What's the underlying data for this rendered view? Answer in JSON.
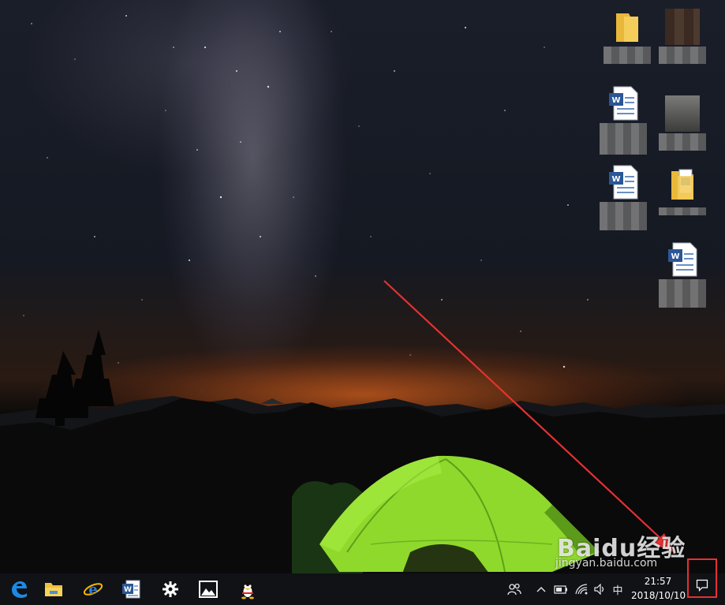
{
  "desktop": {
    "icons": [
      {
        "type": "folder-icon",
        "label": ""
      },
      {
        "type": "image-file-icon",
        "label": ""
      },
      {
        "type": "word-document-icon",
        "label": ""
      },
      {
        "type": "image-file-icon",
        "label": ""
      },
      {
        "type": "word-document-icon",
        "label": ""
      },
      {
        "type": "folder-with-documents-icon",
        "label": ""
      },
      {
        "type": "word-document-icon",
        "label": ""
      }
    ]
  },
  "taskbar": {
    "apps": [
      {
        "name": "Microsoft Edge",
        "icon": "edge-icon"
      },
      {
        "name": "File Explorer",
        "icon": "folder-icon"
      },
      {
        "name": "Internet Explorer",
        "icon": "internet-explorer-icon"
      },
      {
        "name": "Microsoft Word",
        "icon": "word-icon"
      },
      {
        "name": "Settings",
        "icon": "gear-icon"
      },
      {
        "name": "Photos",
        "icon": "photos-icon"
      },
      {
        "name": "QQ",
        "icon": "qq-penguin-icon"
      }
    ],
    "tray": {
      "input_method": "中",
      "clock_time": "21:57",
      "clock_date": "2018/10/10"
    }
  },
  "watermark": {
    "main": "Baidu经验",
    "sub": "jingyan.baidu.com"
  },
  "colors": {
    "highlight": "#e53131",
    "taskbar": "#101216",
    "tent": "#8fd92c",
    "edge_blue": "#1b8ae6"
  }
}
